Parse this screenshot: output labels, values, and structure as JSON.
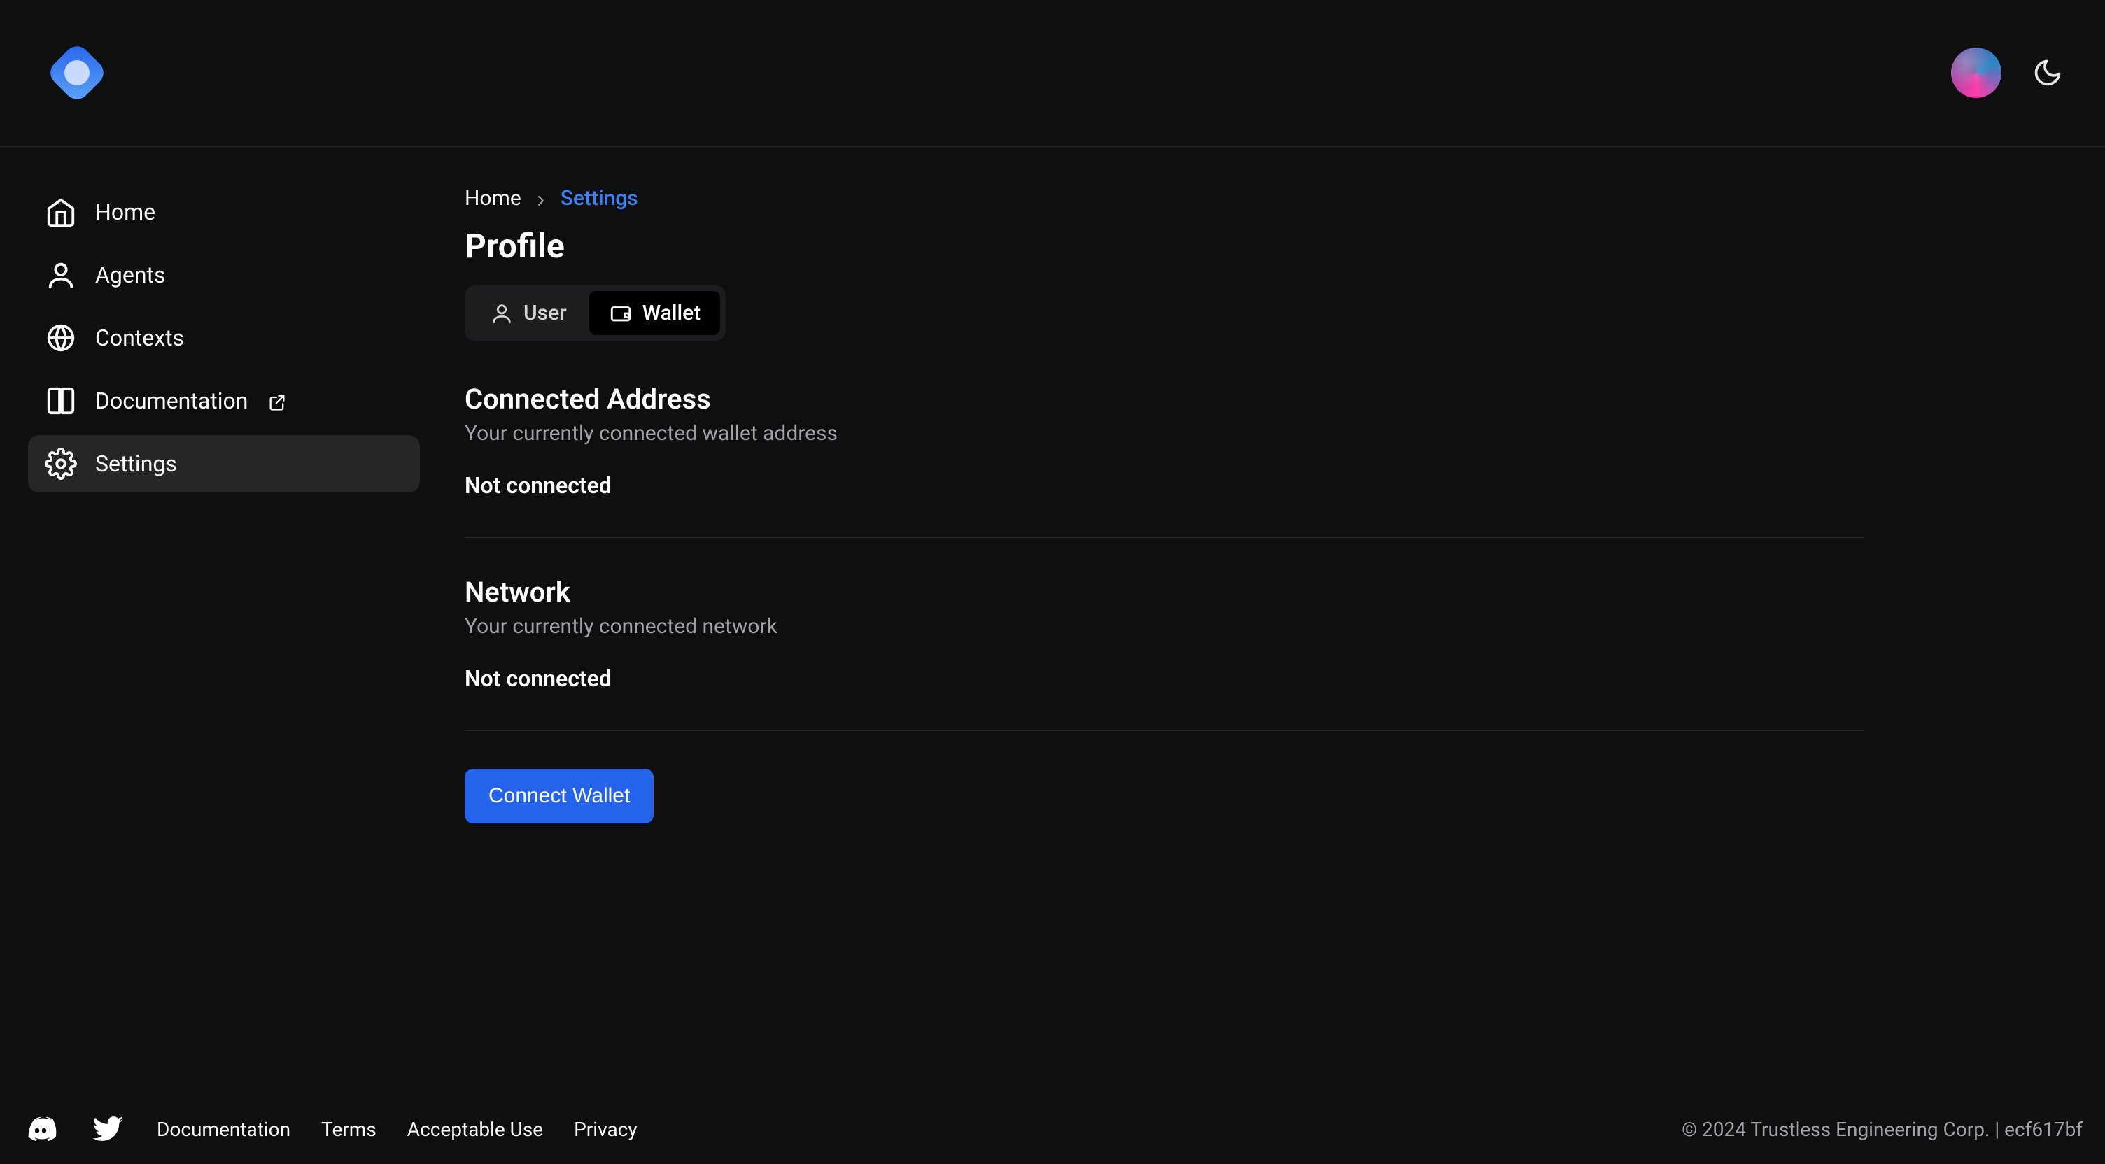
{
  "header": {
    "brand": "app-logo"
  },
  "sidebar": {
    "items": [
      {
        "label": "Home"
      },
      {
        "label": "Agents"
      },
      {
        "label": "Contexts"
      },
      {
        "label": "Documentation"
      },
      {
        "label": "Settings"
      }
    ]
  },
  "breadcrumb": {
    "home": "Home",
    "current": "Settings"
  },
  "page": {
    "title": "Profile"
  },
  "tabs": {
    "user": "User",
    "wallet": "Wallet"
  },
  "wallet": {
    "address_title": "Connected Address",
    "address_desc": "Your currently connected wallet address",
    "address_value": "Not connected",
    "network_title": "Network",
    "network_desc": "Your currently connected network",
    "network_value": "Not connected",
    "connect_label": "Connect Wallet"
  },
  "footer": {
    "links": {
      "documentation": "Documentation",
      "terms": "Terms",
      "acceptable_use": "Acceptable Use",
      "privacy": "Privacy"
    },
    "copyright": "© 2024 Trustless Engineering Corp. | ecf617bf"
  }
}
